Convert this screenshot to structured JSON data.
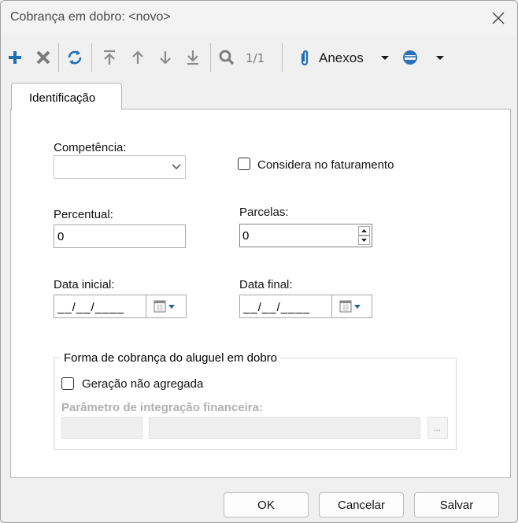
{
  "window": {
    "title": "Cobrança em dobro: <novo>"
  },
  "toolbar": {
    "pager": "1/1",
    "anexos_label": "Anexos"
  },
  "tabs": [
    {
      "label": "Identificação"
    }
  ],
  "form": {
    "competencia_label": "Competência:",
    "competencia_value": "",
    "considera_label": "Considera no faturamento",
    "percentual_label": "Percentual:",
    "percentual_value": "0",
    "parcelas_label": "Parcelas:",
    "parcelas_value": "0",
    "data_inicial_label": "Data inicial:",
    "data_inicial_value": "__/__/____",
    "data_final_label": "Data final:",
    "data_final_value": "__/__/____"
  },
  "group": {
    "title": "Forma de cobrança do aluguel em dobro",
    "geracao_label": "Geração não agregada",
    "parametro_label": "Parâmetro de integração financeira:",
    "browse_label": "..."
  },
  "buttons": {
    "ok": "OK",
    "cancelar": "Cancelar",
    "salvar": "Salvar"
  },
  "colors": {
    "accent": "#1f6fb8",
    "disabled_text": "#b0b0b0"
  }
}
